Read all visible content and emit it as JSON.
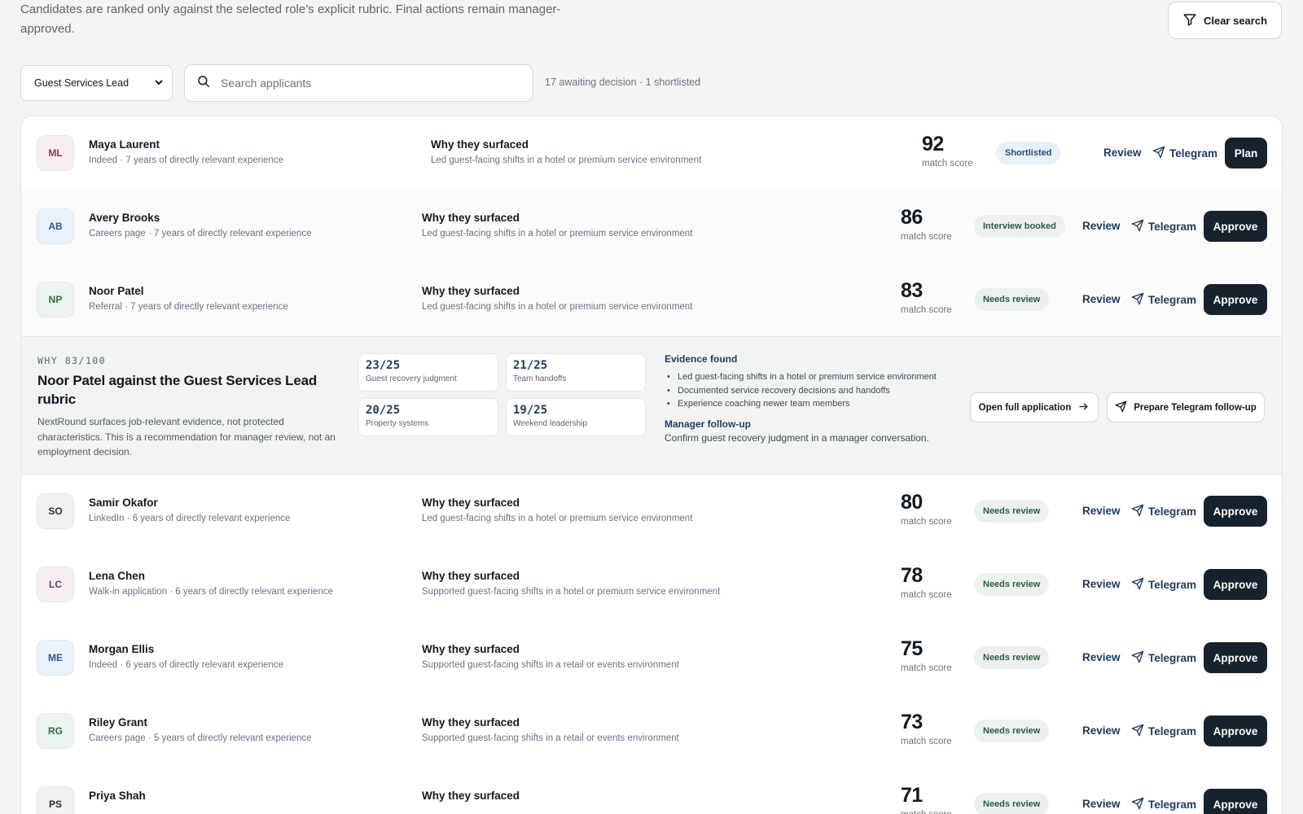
{
  "header": {
    "intro": "Candidates are ranked only against the selected role’s explicit rubric. Final actions remain manager-approved.",
    "clear_search": "Clear search"
  },
  "filters": {
    "role": "Guest Services Lead",
    "search_placeholder": "Search applicants",
    "search_value": "",
    "counts": "17 awaiting decision · 1 shortlisted"
  },
  "labels": {
    "why_heading": "Why they surfaced",
    "match_score": "match score",
    "review": "Review",
    "telegram": "Telegram"
  },
  "candidates": [
    {
      "initials": "ML",
      "name": "Maya Laurent",
      "meta": "Indeed · 7 years of directly relevant experience",
      "why": "Led guest-facing shifts in a hotel or premium service environment",
      "score": "92",
      "status": "Shortlisted",
      "action": "Plan"
    },
    {
      "initials": "AB",
      "name": "Avery Brooks",
      "meta": "Careers page · 7 years of directly relevant experience",
      "why": "Led guest-facing shifts in a hotel or premium service environment",
      "score": "86",
      "status": "Interview booked",
      "action": "Approve"
    },
    {
      "initials": "NP",
      "name": "Noor Patel",
      "meta": "Referral · 7 years of directly relevant experience",
      "why": "Led guest-facing shifts in a hotel or premium service environment",
      "score": "83",
      "status": "Needs review",
      "action": "Approve"
    },
    {
      "initials": "SO",
      "name": "Samir Okafor",
      "meta": "LinkedIn · 6 years of directly relevant experience",
      "why": "Led guest-facing shifts in a hotel or premium service environment",
      "score": "80",
      "status": "Needs review",
      "action": "Approve"
    },
    {
      "initials": "LC",
      "name": "Lena Chen",
      "meta": "Walk-in application · 6 years of directly relevant experience",
      "why": "Supported guest-facing shifts in a hotel or premium service environment",
      "score": "78",
      "status": "Needs review",
      "action": "Approve"
    },
    {
      "initials": "ME",
      "name": "Morgan Ellis",
      "meta": "Indeed · 6 years of directly relevant experience",
      "why": "Supported guest-facing shifts in a retail or events environment",
      "score": "75",
      "status": "Needs review",
      "action": "Approve"
    },
    {
      "initials": "RG",
      "name": "Riley Grant",
      "meta": "Careers page · 5 years of directly relevant experience",
      "why": "Supported guest-facing shifts in a retail or events environment",
      "score": "73",
      "status": "Needs review",
      "action": "Approve"
    },
    {
      "initials": "PS",
      "name": "Priya Shah",
      "meta": "",
      "why": "",
      "score": "71",
      "status": "Needs review",
      "action": "Approve"
    }
  ],
  "detail": {
    "kicker": "WHY 83/100",
    "title": "Noor Patel against the Guest Services Lead rubric",
    "note": "NextRound surfaces job-relevant evidence, not protected characteristics. This is a recommendation for manager review, not an employment decision.",
    "criteria": [
      {
        "score": "23/25",
        "label": "Guest recovery judgment"
      },
      {
        "score": "21/25",
        "label": "Team handoffs"
      },
      {
        "score": "20/25",
        "label": "Property systems"
      },
      {
        "score": "19/25",
        "label": "Weekend leadership"
      }
    ],
    "evidence_heading": "Evidence found",
    "evidence": [
      "Led guest-facing shifts in a hotel or premium service environment",
      "Documented service recovery decisions and handoffs",
      "Experience coaching newer team members"
    ],
    "followup_heading": "Manager follow-up",
    "followup_text": "Confirm guest recovery judgment in a manager conversation.",
    "open_label": "Open full application",
    "prepare_label": "Prepare Telegram follow-up"
  },
  "colors": {
    "avatars": [
      {
        "bg": "#f8eef0",
        "fg": "#8a3550"
      },
      {
        "bg": "#eaf1fa",
        "fg": "#2a5a90"
      },
      {
        "bg": "#ebf4ee",
        "fg": "#2e6b45"
      },
      {
        "bg": "#f0f2f1",
        "fg": "#27313b"
      },
      {
        "bg": "#f8eef0",
        "fg": "#8a3550"
      },
      {
        "bg": "#eaf1fa",
        "fg": "#2a5a90"
      },
      {
        "bg": "#ebf4ee",
        "fg": "#2e6b45"
      },
      {
        "bg": "#f0f2f1",
        "fg": "#27313b"
      }
    ]
  }
}
